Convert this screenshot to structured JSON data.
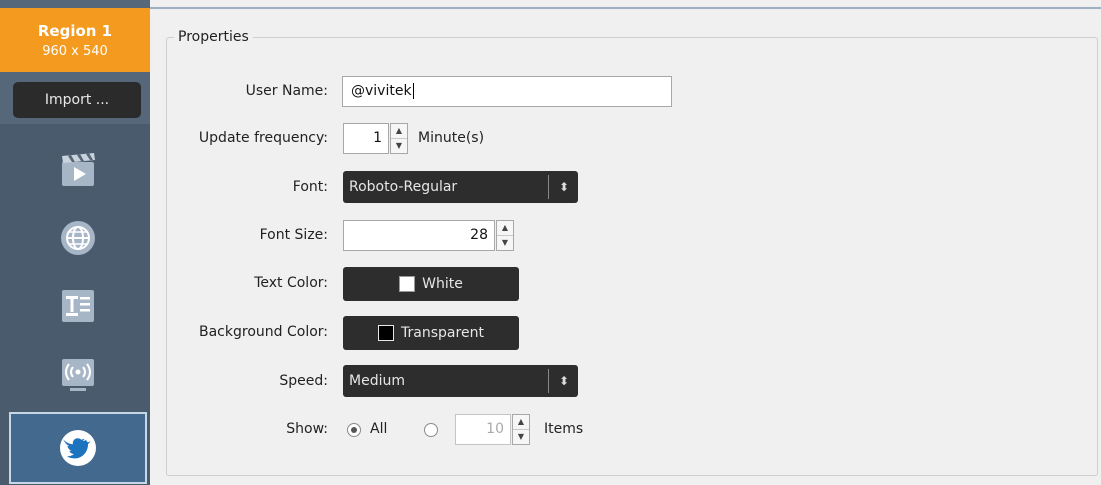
{
  "sidebar": {
    "region": {
      "name": "Region 1",
      "size": "960 x 540"
    },
    "import_label": "Import ...",
    "items": [
      {
        "icon": "clapperboard-icon"
      },
      {
        "icon": "globe-icon"
      },
      {
        "icon": "text-icon"
      },
      {
        "icon": "broadcast-icon"
      },
      {
        "icon": "twitter-icon",
        "active": true
      }
    ]
  },
  "properties": {
    "title": "Properties",
    "user_name": {
      "label": "User Name:",
      "value": "@vivitek"
    },
    "update_frequency": {
      "label": "Update frequency:",
      "value": "1",
      "unit": "Minute(s)"
    },
    "font": {
      "label": "Font:",
      "value": "Roboto-Regular"
    },
    "font_size": {
      "label": "Font Size:",
      "value": "28"
    },
    "text_color": {
      "label": "Text Color:",
      "value": "White",
      "swatch": "#ffffff"
    },
    "background_color": {
      "label": "Background Color:",
      "value": "Transparent",
      "swatch": "#000000"
    },
    "speed": {
      "label": "Speed:",
      "value": "Medium"
    },
    "show": {
      "label": "Show:",
      "all_label": "All",
      "count": "10",
      "items_label": "Items"
    }
  },
  "colors": {
    "accent": "#f39a1f",
    "sidebar": "#56677a",
    "dark_button": "#2d2d2d"
  }
}
